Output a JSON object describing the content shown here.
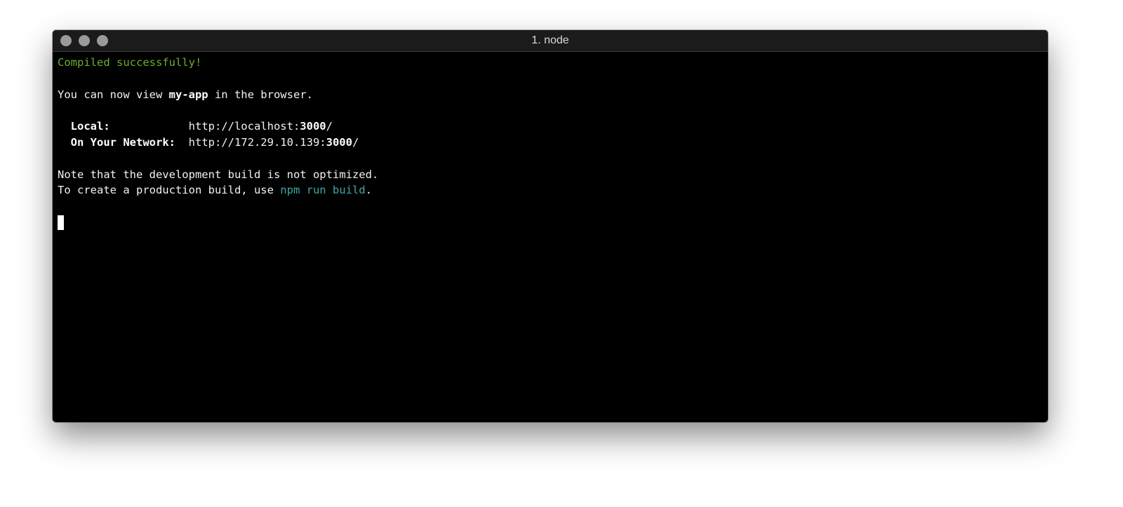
{
  "window": {
    "title": "1. node"
  },
  "terminal": {
    "compiled": "Compiled successfully!",
    "view_prefix": "You can now view ",
    "app_name": "my-app",
    "view_suffix": " in the browser.",
    "local_label": "Local:",
    "local_url_prefix": "http://localhost:",
    "local_port": "3000",
    "local_url_suffix": "/",
    "network_label": "On Your Network:",
    "network_url_prefix": "http://172.29.10.139:",
    "network_port": "3000",
    "network_url_suffix": "/",
    "note": "Note that the development build is not optimized.",
    "prod_prefix": "To create a production build, use ",
    "prod_command": "npm run build",
    "prod_suffix": "."
  },
  "colors": {
    "success": "#6cae2e",
    "command": "#3fa7a9"
  }
}
